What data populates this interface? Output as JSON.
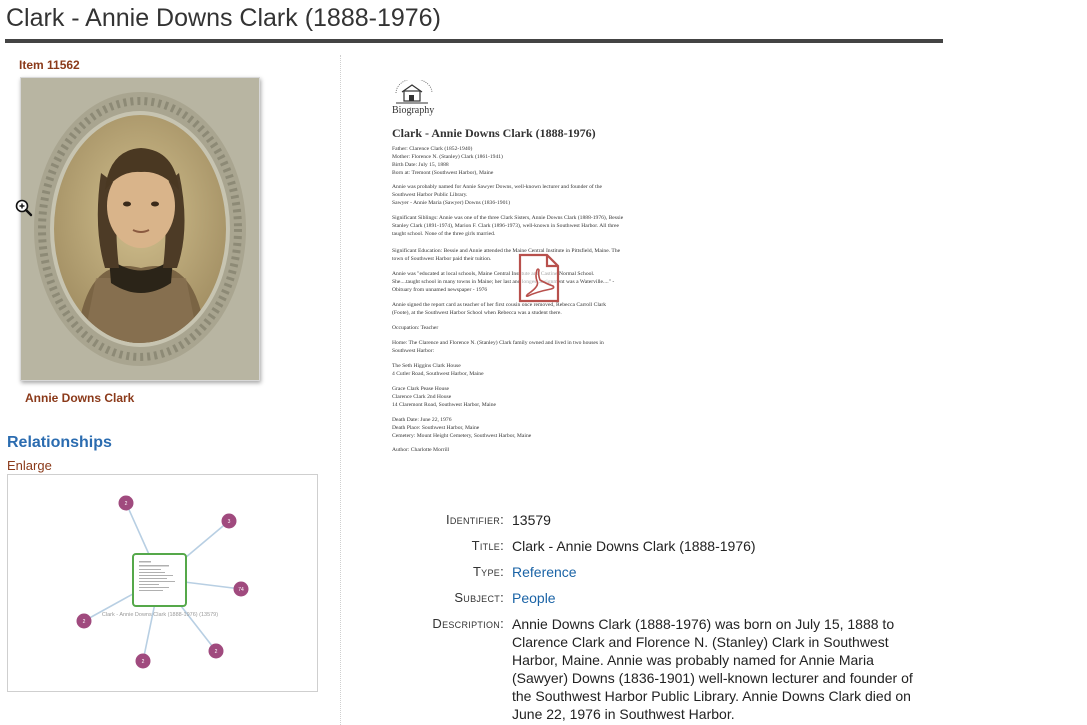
{
  "page": {
    "title": "Clark - Annie Downs Clark (1888-1976)"
  },
  "item": {
    "label": "Item 11562",
    "image_caption": "Annie Downs Clark"
  },
  "relationships": {
    "heading": "Relationships",
    "enlarge_label": "Enlarge",
    "center_caption": "Clark - Annie Downs Clark (1888-1976) (13579)",
    "node_counts": [
      "2",
      "3",
      "74",
      "2",
      "2",
      "2"
    ]
  },
  "document": {
    "org": "Biography",
    "heading": "Clark - Annie Downs Clark (1888-1976)",
    "lines": [
      "Father: Clarence Clark (1852-1940)",
      "Mother: Florence N. (Stanley) Clark (1861-1941)",
      "Birth Date: July 15, 1888",
      "Born at: Tremont (Southwest Harbor), Maine",
      "Annie was probably named for Annie Sawyer Downs, well-known lecturer and founder of the",
      "Southwest Harbor Public Library.",
      "Sawyer - Annie Maria (Sawyer) Downs (1836-1901)",
      "Significant Siblings: Annie was one of the three Clark Sisters, Annie Downs Clark (1888-1976), Bessie",
      "Stanley Clark (1891-1974), Marion F. Clark (1896-1973), well-known in Southwest Harbor. All three",
      "taught school. None of the three girls married.",
      "Significant Education: Bessie and Annie attended the Maine Central Institute in Pittsfield, Maine. The",
      "town of Southwest Harbor paid their tuition.",
      "Annie was \"educated at local schools, Maine Central Institute and Castine Normal School.",
      "She....taught school in many towns in Maine; her last and longest assignment was a Waterville....\" -",
      "Obituary from unnamed newspaper - 1976",
      "Annie signed the report card as teacher of her first cousin once removed, Rebecca Carroll Clark",
      "(Foote), at the Southwest Harbor School when Rebecca was a student there.",
      "Occupation: Teacher",
      "Home: The Clarence and Florence N. (Stanley) Clark family owned and lived in two houses in",
      "Southwest Harbor:",
      "The Seth Higgins Clark House",
      "4 Cutler Road, Southwest Harbor, Maine",
      "Grace Clark Pease House",
      "Clarence Clark 2nd House",
      "14 Claremont Road, Southwest Harbor, Maine",
      "Death Date: June 22, 1976",
      "Death Place: Southwest Harbor, Maine",
      "Cemetery: Mount Height Cemetery, Southwest Harbor, Maine",
      "Author: Charlotte Morrill"
    ]
  },
  "metadata": {
    "identifier": {
      "label": "Identifier:",
      "value": "13579"
    },
    "title": {
      "label": "Title:",
      "value": "Clark - Annie Downs Clark (1888-1976)"
    },
    "type": {
      "label": "Type:",
      "value": "Reference"
    },
    "subject": {
      "label": "Subject:",
      "value": "People"
    },
    "description": {
      "label": "Description:",
      "value": "Annie Downs Clark (1888-1976) was born on July 15, 1888 to Clarence Clark and Florence N. (Stanley) Clark in Southwest Harbor, Maine. Annie was probably named for Annie Maria (Sawyer) Downs (1836-1901) well-known lecturer and founder of the Southwest Harbor Public Library. Annie Downs Clark died on June 22, 1976 in Southwest Harbor."
    }
  },
  "colors": {
    "accent_brown": "#8b3a1a",
    "link_blue": "#1a63a6",
    "heading_blue": "#2b6cb0",
    "node_purple": "#a04a7e",
    "center_node_green": "#55a84a",
    "pdf_icon_red": "#b8504c"
  }
}
